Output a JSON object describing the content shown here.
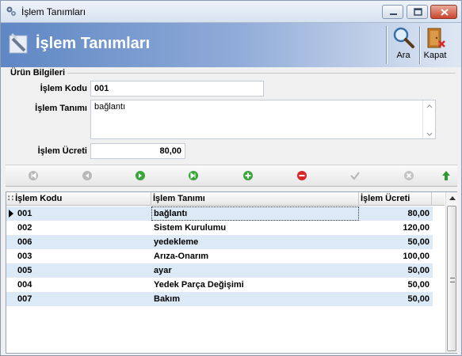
{
  "window": {
    "title": "İşlem Tanımları"
  },
  "header": {
    "title": "İşlem Tanımları"
  },
  "toolbar": {
    "search_label": "Ara",
    "close_label": "Kapat"
  },
  "form": {
    "section_title": "Ürün Bilgileri",
    "code_label": "İşlem Kodu",
    "code_value": "001",
    "desc_label": "İşlem Tanımı",
    "desc_value": "bağlantı",
    "fee_label": "İşlem Ücreti",
    "fee_value": "80,00"
  },
  "grid": {
    "columns": [
      "İşlem Kodu",
      "İşlem Tanımı",
      "İşlem Ücreti"
    ],
    "rows": [
      {
        "kod": "001",
        "tanim": "bağlantı",
        "ucret": "80,00"
      },
      {
        "kod": "002",
        "tanim": "Sistem Kurulumu",
        "ucret": "120,00"
      },
      {
        "kod": "006",
        "tanim": "yedekleme",
        "ucret": "50,00"
      },
      {
        "kod": "003",
        "tanim": "Arıza-Onarım",
        "ucret": "100,00"
      },
      {
        "kod": "005",
        "tanim": "ayar",
        "ucret": "50,00"
      },
      {
        "kod": "004",
        "tanim": "Yedek Parça Değişimi",
        "ucret": "50,00"
      },
      {
        "kod": "007",
        "tanim": "Bakım",
        "ucret": "50,00"
      }
    ]
  },
  "icons": {
    "app": "gears-icon",
    "header": "tools-icon",
    "search": "magnifier-icon",
    "close": "exit-door-icon",
    "nav": [
      "first-icon",
      "prior-icon",
      "next-icon",
      "last-icon",
      "insert-icon",
      "delete-icon",
      "post-icon",
      "cancel-icon",
      "refresh-icon"
    ]
  },
  "colors": {
    "header_start": "#5f87c4",
    "row_alt": "#dce9f7",
    "nav_green": "#3aa53a",
    "nav_red": "#d8262b"
  }
}
